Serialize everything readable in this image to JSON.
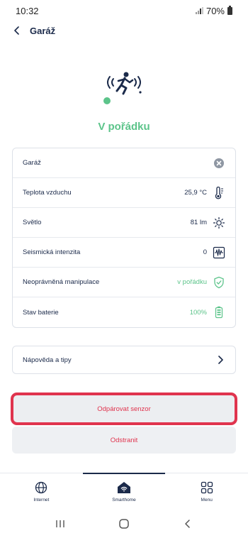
{
  "status_bar": {
    "time": "10:32",
    "battery": "70%"
  },
  "header": {
    "title": "Garáž"
  },
  "hero": {
    "status": "V pořádku",
    "icon": "running-person-motion-icon",
    "status_color": "#5cc48a"
  },
  "details": {
    "rows": [
      {
        "label": "Garáž",
        "value": "",
        "icon": "clear-icon"
      },
      {
        "label": "Teplota vzduchu",
        "value": "25,9 °C",
        "icon": "thermometer-icon"
      },
      {
        "label": "Světlo",
        "value": "81 lm",
        "icon": "sun-icon"
      },
      {
        "label": "Seismická intenzita",
        "value": "0",
        "icon": "seismograph-icon"
      },
      {
        "label": "Neoprávněná manipulace",
        "value": "v pořádku",
        "icon": "shield-check-icon"
      },
      {
        "label": "Stav baterie",
        "value": "100%",
        "icon": "battery-icon"
      }
    ]
  },
  "help": {
    "label": "Nápověda a tipy"
  },
  "actions": {
    "unpair_label": "Odpárovat senzor",
    "remove_label": "Odstranit",
    "danger_color": "#e0344e"
  },
  "bottom_nav": {
    "items": [
      {
        "label": "Internet",
        "icon": "globe-icon"
      },
      {
        "label": "Smarthome",
        "icon": "home-wifi-icon"
      },
      {
        "label": "Menu",
        "icon": "grid-icon"
      }
    ],
    "active": "Smarthome"
  },
  "colors": {
    "primary": "#1b2a4a",
    "ok": "#5cc48a"
  }
}
